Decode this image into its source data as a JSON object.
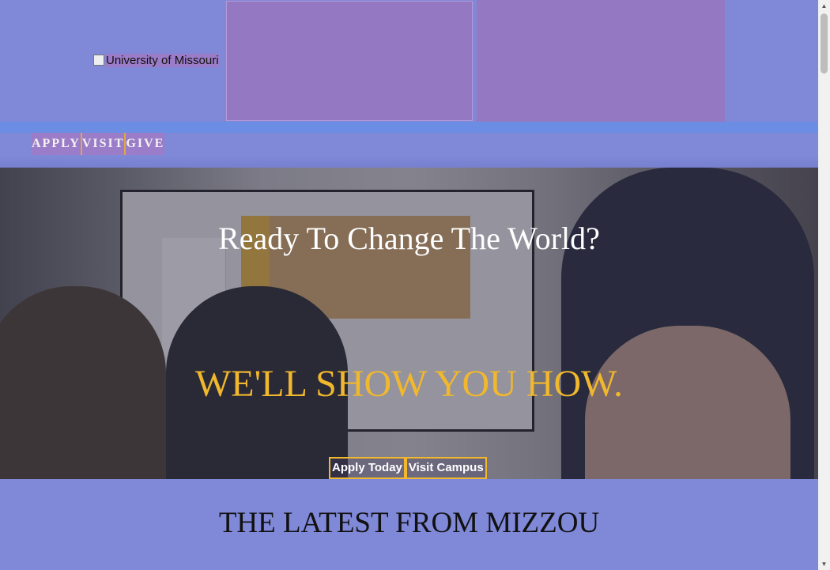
{
  "header": {
    "logo_alt": "University of Missouri"
  },
  "nav": {
    "items": [
      {
        "label": "APPLY"
      },
      {
        "label": "VISIT"
      },
      {
        "label": "GIVE"
      }
    ]
  },
  "hero": {
    "headline": "Ready To Change The World?",
    "tagline": "WE'LL SHOW YOU HOW.",
    "buttons": [
      {
        "label": "Apply Today"
      },
      {
        "label": "Visit Campus"
      }
    ]
  },
  "sections": {
    "latest_title": "THE LATEST FROM MIZZOU"
  },
  "colors": {
    "background": "#8088d8",
    "accent_gold": "#f1b82d",
    "nav_blue": "#6b8ee4"
  },
  "icons": {
    "scroll_up": "triangle-up",
    "scroll_down": "triangle-down",
    "broken_image": "broken-image-icon"
  }
}
